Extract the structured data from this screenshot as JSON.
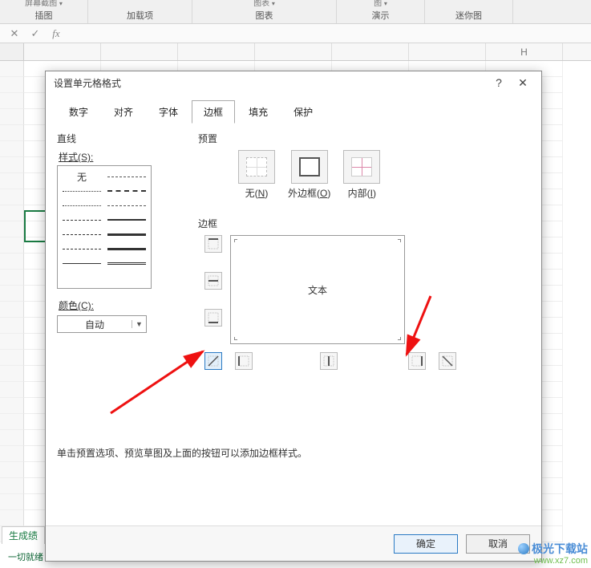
{
  "ribbon": {
    "groups": [
      {
        "top": "屏幕截图",
        "label": "插图"
      },
      {
        "top": "",
        "label": "加载项"
      },
      {
        "top": "图表",
        "label": "图表"
      },
      {
        "top": "图",
        "label": "演示"
      },
      {
        "top": "",
        "label": "迷你图"
      }
    ]
  },
  "formula_bar": {
    "cancel": "✕",
    "confirm": "✓",
    "fx": "fx"
  },
  "grid": {
    "columns": [
      "",
      "",
      "",
      "",
      "",
      "",
      "H"
    ]
  },
  "sheet_tabs": {
    "tab1": "生成绩",
    "tab2": "一切就绪"
  },
  "dialog": {
    "title": "设置单元格格式",
    "help": "?",
    "close": "✕",
    "tabs": {
      "number": "数字",
      "align": "对齐",
      "font": "字体",
      "border": "边框",
      "fill": "填充",
      "protect": "保护"
    },
    "line": {
      "title": "直线",
      "style_label": "样式(S):",
      "none": "无",
      "color_label": "颜色(C):",
      "color_value": "自动"
    },
    "presets": {
      "title": "预置",
      "none": "无(N)",
      "outer": "外边框(O)",
      "inside": "内部(I)"
    },
    "border": {
      "title": "边框",
      "preview_text": "文本"
    },
    "hint": "单击预置选项、预览草图及上面的按钮可以添加边框样式。",
    "buttons": {
      "ok": "确定",
      "cancel": "取消"
    }
  },
  "watermark": {
    "line1": "极光下载站",
    "line2": "www.xz7.com"
  }
}
